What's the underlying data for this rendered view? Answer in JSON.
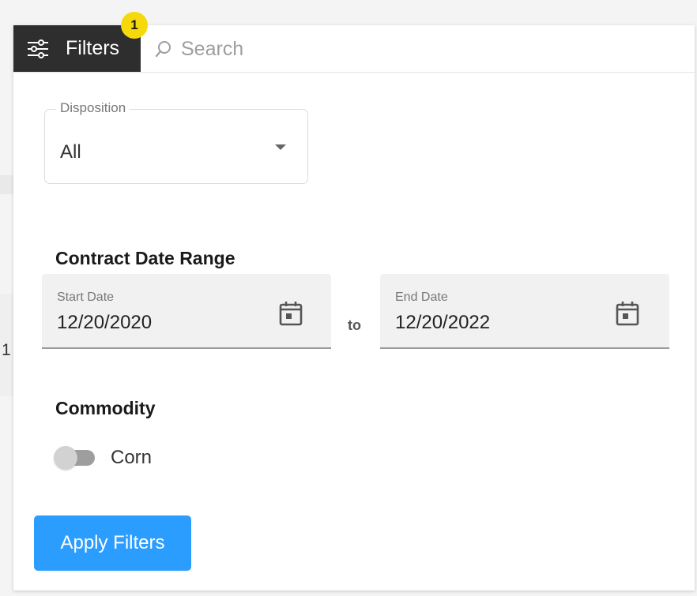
{
  "toolbar": {
    "filters_label": "Filters",
    "badge_count": "1",
    "search_placeholder": "Search"
  },
  "disposition": {
    "label": "Disposition",
    "value": "All"
  },
  "contract_date_range": {
    "title": "Contract Date Range",
    "start": {
      "label": "Start Date",
      "value": "12/20/2020"
    },
    "separator": "to",
    "end": {
      "label": "End Date",
      "value": "12/20/2022"
    }
  },
  "commodity": {
    "title": "Commodity",
    "toggle_label": "Corn",
    "toggle_on": false
  },
  "apply_button_label": "Apply Filters",
  "backdrop": {
    "partial_digit": "1"
  },
  "icons": {
    "filters": "sliders-icon",
    "search": "search-icon",
    "dropdown": "caret-down-icon",
    "calendar": "calendar-icon"
  },
  "colors": {
    "filters_tab_bg": "#2e2e2e",
    "badge_bg": "#f5d90a",
    "apply_button_bg": "#2b9dff",
    "toggle_track": "#9e9e9e"
  }
}
